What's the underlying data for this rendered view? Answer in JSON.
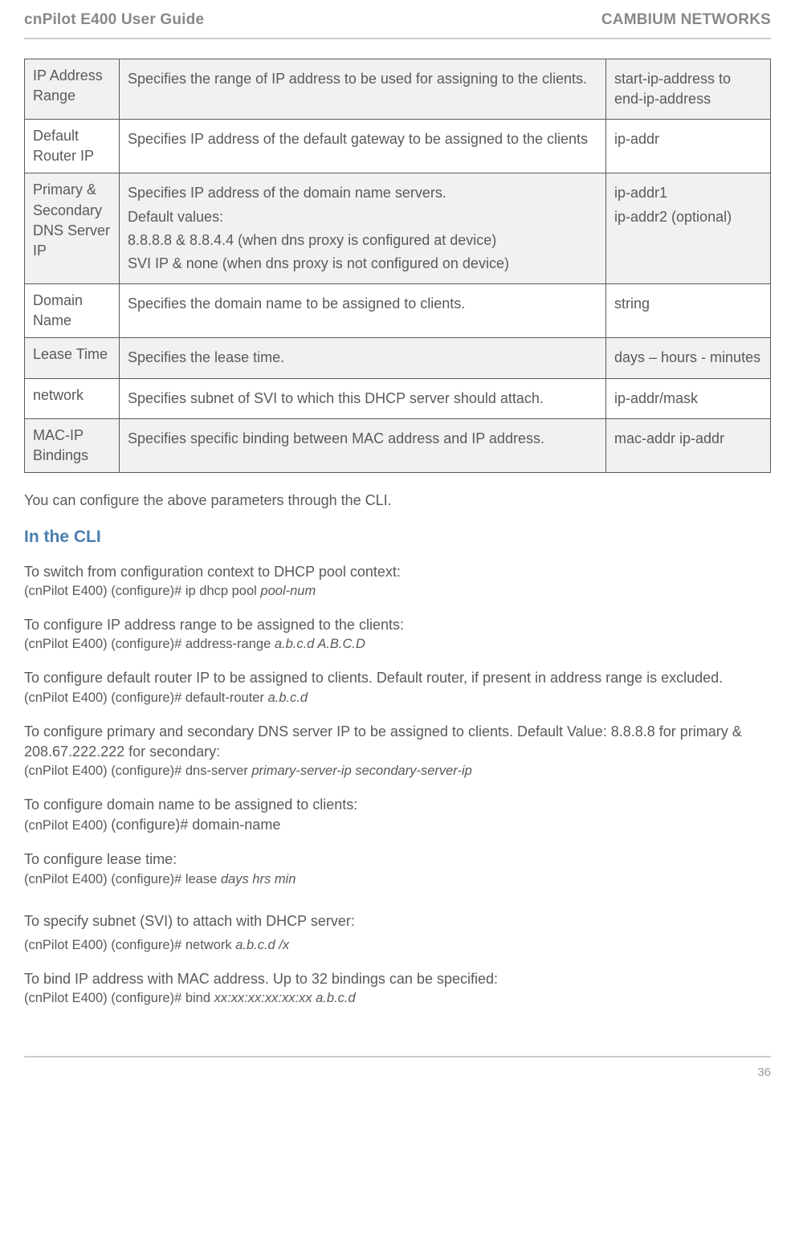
{
  "header": {
    "left": "cnPilot E400 User Guide",
    "right": "CAMBIUM NETWORKS"
  },
  "table_rows": [
    {
      "name": "IP Address Range",
      "desc": [
        "Specifies the range of IP address to be used for assigning to the clients."
      ],
      "val": [
        "start-ip-address to end-ip-address"
      ],
      "alt": true
    },
    {
      "name": "Default Router IP",
      "desc": [
        "Specifies IP address of the default gateway to be assigned to the clients"
      ],
      "val": [
        "ip-addr"
      ],
      "alt": false
    },
    {
      "name": "Primary & Secondary DNS Server IP",
      "desc": [
        "Specifies IP address of the domain name servers.",
        "Default values:",
        "8.8.8.8 & 8.8.4.4 (when dns proxy is configured at device)",
        "SVI IP & none (when dns proxy is not configured on device)"
      ],
      "val": [
        "ip-addr1",
        "ip-addr2 (optional)"
      ],
      "alt": true
    },
    {
      "name": "Domain Name",
      "desc": [
        "Specifies the domain name to be assigned to clients."
      ],
      "val": [
        "string"
      ],
      "alt": false
    },
    {
      "name": "Lease Time",
      "desc": [
        "Specifies the lease time."
      ],
      "val": [
        "days – hours - minutes"
      ],
      "alt": true
    },
    {
      "name": "network",
      "desc": [
        "Specifies subnet of SVI to which this DHCP server should attach."
      ],
      "val": [
        "ip-addr/mask"
      ],
      "alt": false
    },
    {
      "name": "MAC-IP Bindings",
      "desc": [
        "Specifies specific binding between MAC address and IP address."
      ],
      "val": [
        "mac-addr ip-addr"
      ],
      "alt": true
    }
  ],
  "after_table": "You can configure the above parameters through the CLI.",
  "cli_heading": "In the CLI",
  "cli": [
    {
      "intro": "To switch from configuration context to DHCP pool context:",
      "cmd_prefix": "(cnPilot E400)  (configure)# ip dhcp pool ",
      "cmd_italic": "pool-num",
      "cmd_suffix": ""
    },
    {
      "intro": "To configure IP address range to be assigned to the clients:",
      "cmd_prefix": "(cnPilot E400) (configure)# address-range ",
      "cmd_italic": "a.b.c.d A.B.C.D",
      "cmd_suffix": ""
    },
    {
      "intro": "To configure default router IP to be assigned to clients. Default router, if present in address range is excluded.",
      "cmd_prefix": "(cnPilot E400) (configure)# default-router ",
      "cmd_italic": "a.b.c.d",
      "cmd_suffix": ""
    },
    {
      "intro": "To configure primary and secondary DNS server IP to be assigned to clients. Default Value: 8.8.8.8 for  primary & 208.67.222.222 for secondary:",
      "cmd_prefix": "(cnPilot E400) (configure)# dns-server ",
      "cmd_italic": "primary-server-ip secondary-server-ip",
      "cmd_suffix": ""
    },
    {
      "intro": "To configure domain name to be assigned to clients:",
      "cmd_prefix": "(cnPilot E400) ",
      "cmd_italic": "",
      "cmd_suffix": "(configure)# domain-name",
      "cmd_big": true
    },
    {
      "intro": "To configure lease time:",
      "cmd_prefix": "(cnPilot E400) (configure)# lease ",
      "cmd_italic": "days hrs min",
      "cmd_suffix": ""
    }
  ],
  "cli_gap": [
    {
      "intro": "To specify subnet (SVI) to attach with DHCP server:",
      "cmd_prefix": "(cnPilot E400) (configure)# network ",
      "cmd_italic": "a.b.c.d /x",
      "cmd_suffix": "",
      "gap_before": true
    },
    {
      "intro": "To bind IP address with MAC address. Up to 32 bindings can be specified:",
      "cmd_prefix": "(cnPilot E400) (configure)# bind ",
      "cmd_italic": "xx:xx:xx:xx:xx:xx a.b.c.d",
      "cmd_suffix": ""
    }
  ],
  "page_number": "36"
}
